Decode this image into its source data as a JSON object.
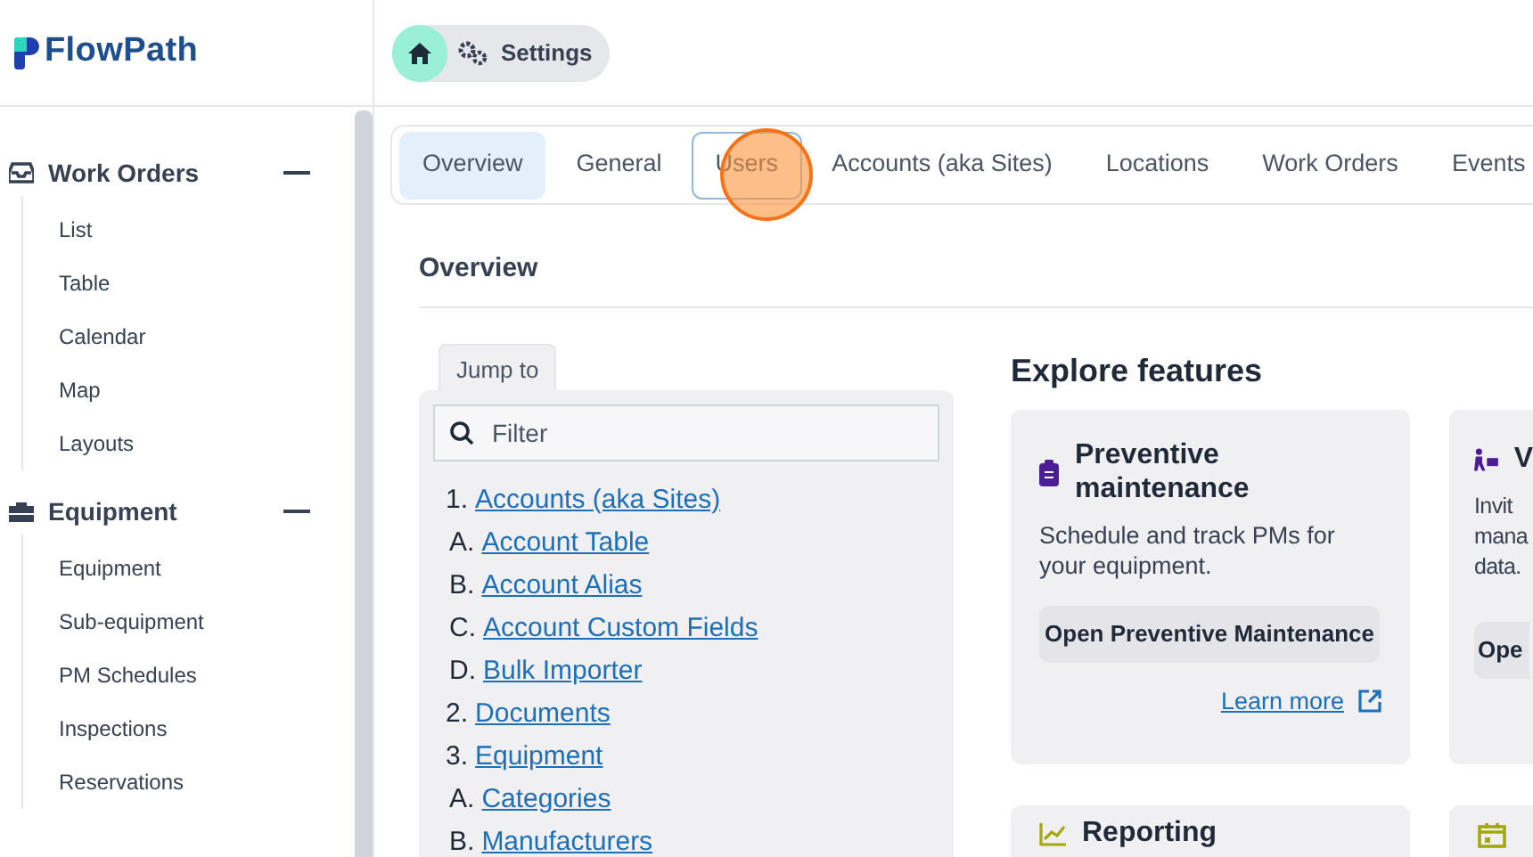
{
  "logo": {
    "text": "FlowPath"
  },
  "breadcrumb": {
    "current": "Settings"
  },
  "sidebar": {
    "sections": [
      {
        "title": "Work Orders",
        "expanded": true,
        "items": [
          "List",
          "Table",
          "Calendar",
          "Map",
          "Layouts"
        ]
      },
      {
        "title": "Equipment",
        "expanded": true,
        "items": [
          "Equipment",
          "Sub-equipment",
          "PM Schedules",
          "Inspections",
          "Reservations"
        ]
      }
    ]
  },
  "tabs": [
    {
      "label": "Overview",
      "selected": true,
      "focused": false
    },
    {
      "label": "General",
      "selected": false,
      "focused": false
    },
    {
      "label": "Users",
      "selected": false,
      "focused": true
    },
    {
      "label": "Accounts (aka Sites)",
      "selected": false,
      "focused": false
    },
    {
      "label": "Locations",
      "selected": false,
      "focused": false
    },
    {
      "label": "Work Orders",
      "selected": false,
      "focused": false
    },
    {
      "label": "Events",
      "selected": false,
      "focused": false
    }
  ],
  "page_title": "Overview",
  "jump_to": {
    "label": "Jump to",
    "placeholder": "Filter",
    "items": [
      {
        "marker": "1.",
        "label": "Accounts (aka Sites)",
        "children": [
          {
            "marker": "A.",
            "label": "Account Table"
          },
          {
            "marker": "B.",
            "label": "Account Alias"
          },
          {
            "marker": "C.",
            "label": "Account Custom Fields"
          },
          {
            "marker": "D.",
            "label": "Bulk Importer"
          }
        ]
      },
      {
        "marker": "2.",
        "label": "Documents"
      },
      {
        "marker": "3.",
        "label": "Equipment",
        "children": [
          {
            "marker": "A.",
            "label": "Categories"
          },
          {
            "marker": "B.",
            "label": "Manufacturers"
          }
        ]
      }
    ]
  },
  "explore": {
    "title": "Explore features",
    "cards": [
      {
        "title": "Preventive maintenance",
        "description": "Schedule and track PMs for your equipment.",
        "button": "Open Preventive Maintenance",
        "link": "Learn more"
      },
      {
        "title": "V",
        "description_lines": [
          "Invit",
          "mana",
          "data."
        ],
        "button": "Ope"
      },
      {
        "title": "Reporting"
      }
    ]
  }
}
